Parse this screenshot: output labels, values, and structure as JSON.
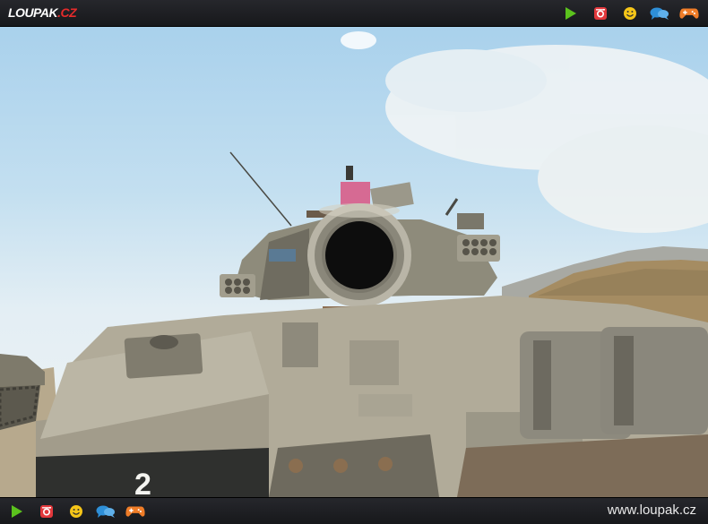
{
  "site": {
    "logo_main": "LOUPAK",
    "logo_tld": ".CZ",
    "url": "www.loupak.cz"
  },
  "icons": [
    "play-icon",
    "instagram-icon",
    "smiley-icon",
    "chat-icon",
    "gamepad-icon"
  ],
  "colors": {
    "bar": "#1d1e22",
    "play": "#5bc21d",
    "instagram": "#e2383c",
    "smiley": "#f5c518",
    "chat": "#2e8fd8",
    "gamepad": "#f07d28",
    "logo_tld": "#e62b2b"
  },
  "photo": {
    "subject": "tank-front-view",
    "turret_number": "2"
  }
}
